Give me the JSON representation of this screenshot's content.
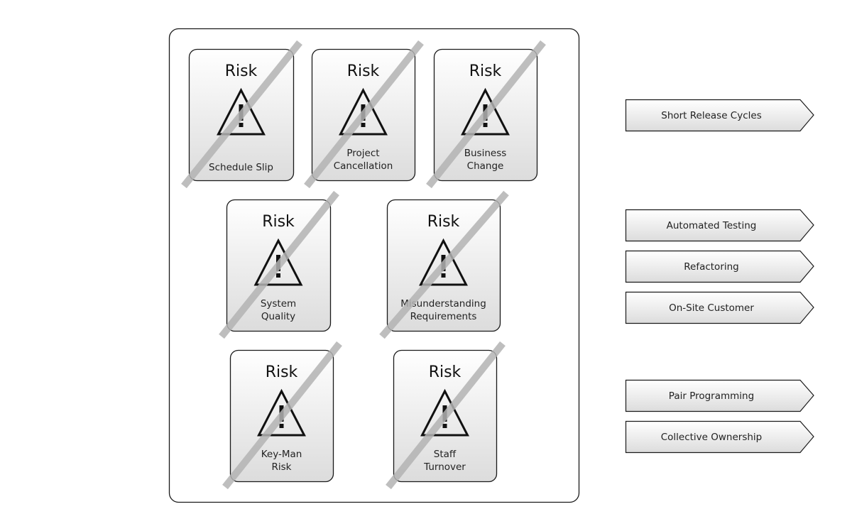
{
  "container": {
    "label": "risk-container"
  },
  "risks": [
    {
      "title": "Risk",
      "label_lines": [
        "Schedule Slip"
      ],
      "icon": "warning-triangle-icon",
      "struck_out": true
    },
    {
      "title": "Risk",
      "label_lines": [
        "Project",
        "Cancellation"
      ],
      "icon": "warning-triangle-icon",
      "struck_out": true
    },
    {
      "title": "Risk",
      "label_lines": [
        "Business",
        "Change"
      ],
      "icon": "warning-triangle-icon",
      "struck_out": true
    },
    {
      "title": "Risk",
      "label_lines": [
        "System",
        "Quality"
      ],
      "icon": "warning-triangle-icon",
      "struck_out": true
    },
    {
      "title": "Risk",
      "label_lines": [
        "Misunderstanding",
        "Requirements"
      ],
      "icon": "warning-triangle-icon",
      "struck_out": true
    },
    {
      "title": "Risk",
      "label_lines": [
        "Key-Man",
        "Risk"
      ],
      "icon": "warning-triangle-icon",
      "struck_out": true
    },
    {
      "title": "Risk",
      "label_lines": [
        "Staff",
        "Turnover"
      ],
      "icon": "warning-triangle-icon",
      "struck_out": true
    }
  ],
  "practices": [
    {
      "label": "Short Release Cycles",
      "group": 1
    },
    {
      "label": "Automated Testing",
      "group": 2
    },
    {
      "label": "Refactoring",
      "group": 2
    },
    {
      "label": "On-Site Customer",
      "group": 2
    },
    {
      "label": "Pair Programming",
      "group": 3
    },
    {
      "label": "Collective Ownership",
      "group": 3
    }
  ],
  "colors": {
    "stroke": "#1a1a1a",
    "card_gradient_top": "#ffffff",
    "card_gradient_bottom": "#dedede",
    "slash": "#b3b3b3",
    "background": "#ffffff"
  }
}
